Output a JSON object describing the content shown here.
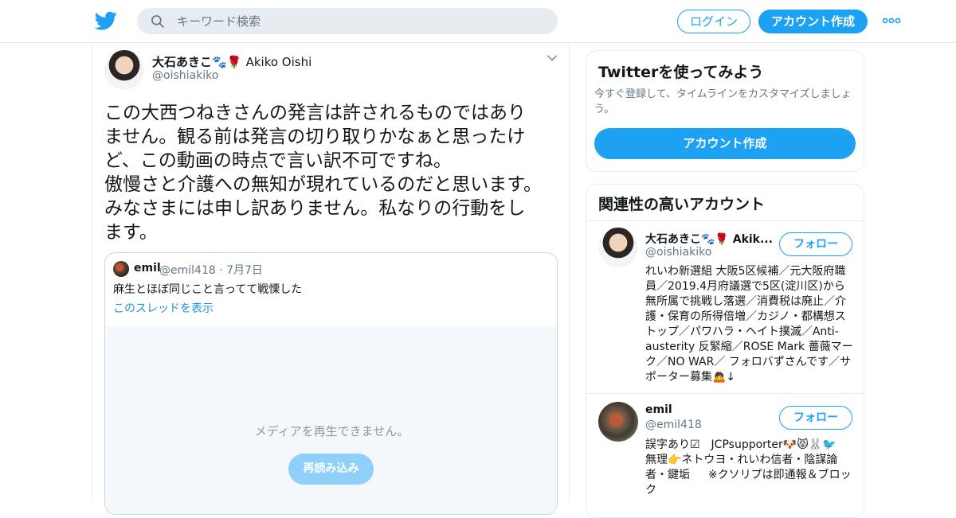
{
  "header": {
    "search_placeholder": "キーワード検索",
    "login_label": "ログイン",
    "signup_label": "アカウント作成"
  },
  "tweet": {
    "author_name": "大石あきこ🐾🌹",
    "author_name_en": "Akiko Oishi",
    "author_handle": "@oishiakiko",
    "text": "この大西つねきさんの発言は許されるものではあり\nません。観る前は発言の切り取りかなぁと思ったけ\nど、この動画の時点で言い訳不可ですね。\n傲慢さと介護への無知が現れているのだと思います。\nみなさまには申し訳ありません。私なりの行動をし\nます。",
    "quoted": {
      "name": "emil",
      "handle_date": "@emil418 · 7月7日",
      "text": "麻生とほぼ同じこと言ってて戦慄した",
      "show_thread": "このスレッドを表示",
      "media_message": "メディアを再生できません。",
      "reload_label": "再読み込み"
    }
  },
  "sidebar": {
    "try_card": {
      "title": "Twitterを使ってみよう",
      "subtitle": "今すぐ登録して、タイムラインをカスタマイズしましょう。",
      "button": "アカウント作成"
    },
    "related": {
      "title": "関連性の高いアカウント",
      "accounts": [
        {
          "name": "大石あきこ🐾🌹 Akik...",
          "handle": "@oishiakiko",
          "follow": "フォロー",
          "bio": "れいわ新選組 大阪5区候補／元大阪府職員／2019.4月府議選で5区(淀川区)から無所属で挑戦し落選／消費税は廃止／介護・保育の所得倍増／カジノ・都構想ストップ／パワハラ・ヘイト撲滅／Anti-austerity 反緊縮／ROSE Mark 薔薇マーク／NO WAR／ フォロバずさんです／サポーター募集🙇↓"
        },
        {
          "name": "emil",
          "handle": "@emil418",
          "follow": "フォロー",
          "bio": "誤字あり☑　JCPsupporter🐶😾🐰🐦　 無理👉ネトウヨ・れいわ信者・陰謀論者・鍵垢 　 ※クソリプは即通報＆ブロック"
        }
      ]
    }
  },
  "colors": {
    "brand": "#1da1f2",
    "link": "#1b95e0",
    "muted": "#657786"
  }
}
